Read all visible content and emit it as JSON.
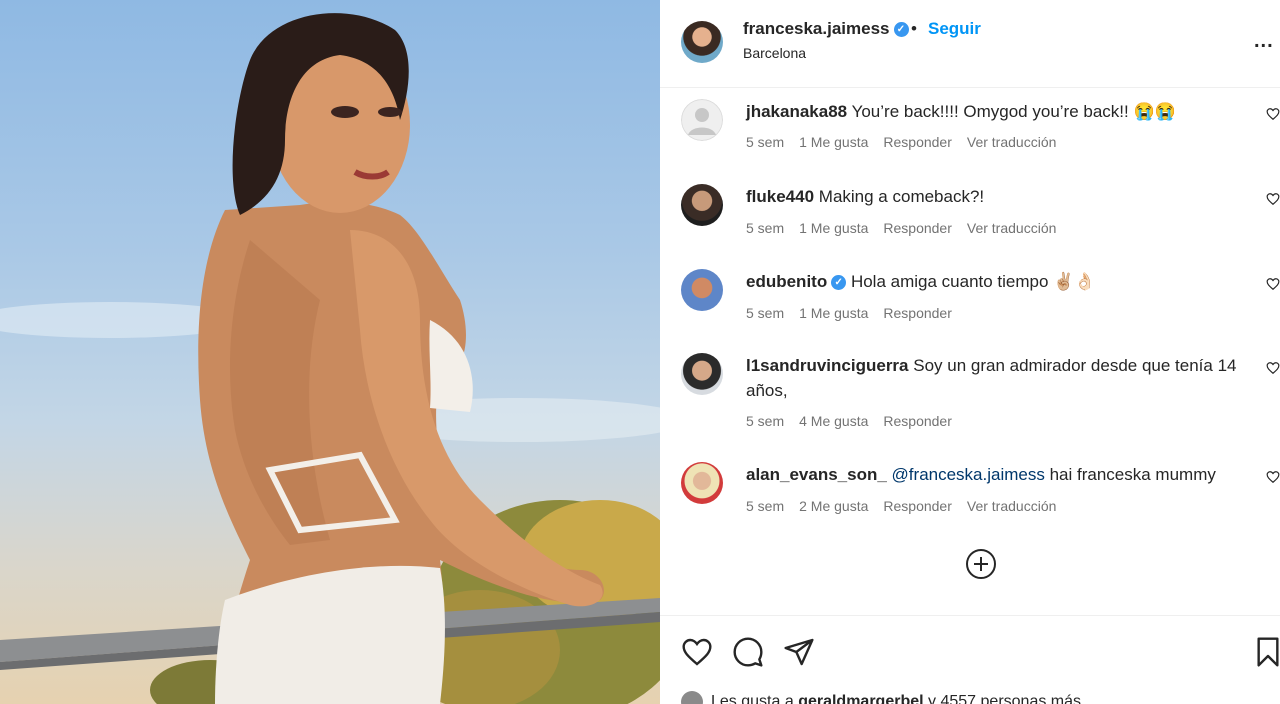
{
  "post": {
    "username": "franceska.jaimess",
    "verified": true,
    "follow_label": "Seguir",
    "separator": "•",
    "location": "Barcelona",
    "more_label": "..."
  },
  "comments": [
    {
      "user": "jhakanaka88",
      "text": "You’re back!!!! Omygod you’re back!! 😭😭",
      "time": "5 sem",
      "likes": "1 Me gusta",
      "reply": "Responder",
      "translate": "Ver traducción",
      "avatar": "default-avatar"
    },
    {
      "user": "fluke440",
      "text": "Making a comeback?!",
      "time": "5 sem",
      "likes": "1 Me gusta",
      "reply": "Responder",
      "translate": "Ver traducción",
      "avatar": "bearded-man"
    },
    {
      "user": "edubenito",
      "verified": true,
      "text": "Hola amiga cuanto tiempo ✌🏼👌🏻",
      "time": "5 sem",
      "likes": "1 Me gusta",
      "reply": "Responder",
      "avatar": "man-blue-bg"
    },
    {
      "user": "l1sandruvinciguerra",
      "text": "Soy un gran admirador desde que tenía 14 años,",
      "time": "5 sem",
      "likes": "4 Me gusta",
      "reply": "Responder",
      "avatar": "man-glasses"
    },
    {
      "user": "alan_evans_son_",
      "mention": "@franceska.jaimess",
      "text": "hai franceska mummy",
      "time": "5 sem",
      "likes": "2 Me gusta",
      "reply": "Responder",
      "translate": "Ver traducción",
      "avatar": "blonde-woman"
    }
  ],
  "actions": {
    "like": "heart-icon",
    "comment": "comment-icon",
    "share": "send-icon",
    "save": "bookmark-icon"
  },
  "likes_line": {
    "prefix": "Les gusta a",
    "user": "geraldmargerbel",
    "suffix": "y 4557 personas más"
  },
  "colors": {
    "follow": "#0095f6",
    "verified": "#3897f0",
    "meta": "#737373",
    "mention": "#00376b"
  }
}
